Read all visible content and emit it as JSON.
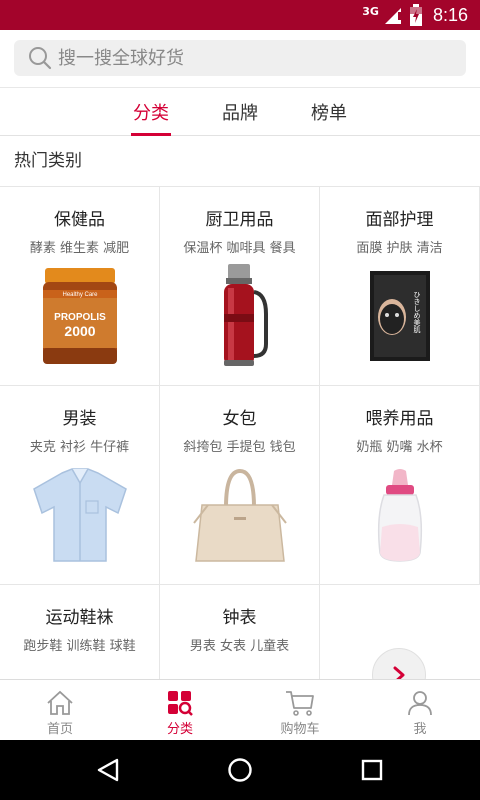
{
  "status_bar": {
    "network": "3G",
    "time": "8:16",
    "color": "#a3042b"
  },
  "search": {
    "placeholder": "搜一搜全球好货"
  },
  "tabs": [
    {
      "label": "分类",
      "active": true
    },
    {
      "label": "品牌",
      "active": false
    },
    {
      "label": "榜单",
      "active": false
    }
  ],
  "section": {
    "title": "热门类别"
  },
  "categories": [
    {
      "title": "保健品",
      "subtitle": "酵素 维生素 减肥",
      "image_label": "PROPOLIS",
      "image_label2": "2000"
    },
    {
      "title": "厨卫用品",
      "subtitle": "保温杯 咖啡具 餐具"
    },
    {
      "title": "面部护理",
      "subtitle": "面膜 护肤 清洁",
      "image_label": "ひきしめ美肌"
    },
    {
      "title": "男装",
      "subtitle": "夹克 衬衫 牛仔裤"
    },
    {
      "title": "女包",
      "subtitle": "斜挎包 手提包 钱包"
    },
    {
      "title": "喂养用品",
      "subtitle": "奶瓶 奶嘴 水杯"
    },
    {
      "title": "运动鞋袜",
      "subtitle": "跑步鞋 训练鞋 球鞋"
    },
    {
      "title": "钟表",
      "subtitle": "男表 女表 儿童表"
    }
  ],
  "bottom_nav": [
    {
      "label": "首页",
      "icon": "home-icon",
      "active": false
    },
    {
      "label": "分类",
      "icon": "category-icon",
      "active": true
    },
    {
      "label": "购物车",
      "icon": "cart-icon",
      "active": false
    },
    {
      "label": "我",
      "icon": "user-icon",
      "active": false
    }
  ],
  "accent_color": "#d40036",
  "system_nav": {
    "back": "back-icon",
    "home": "home-circle-icon",
    "recents": "recents-icon"
  }
}
